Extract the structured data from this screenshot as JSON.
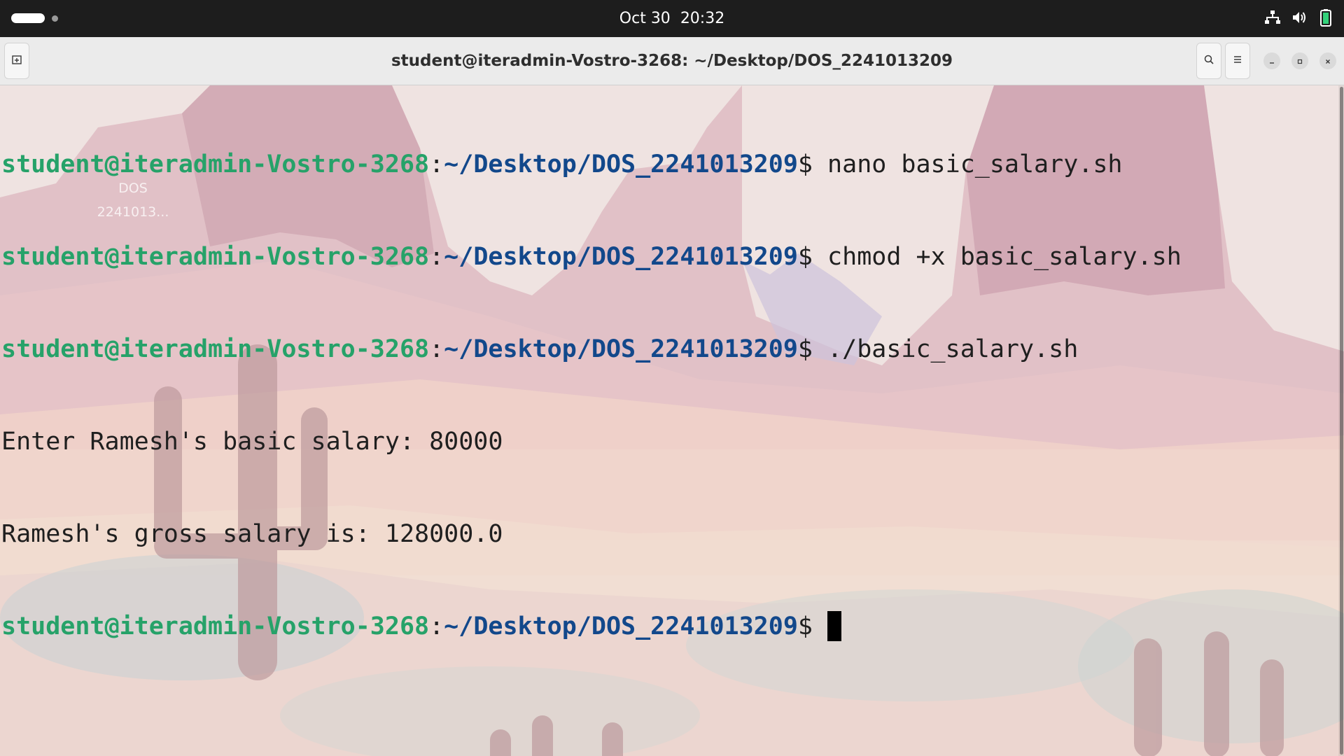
{
  "topbar": {
    "date": "Oct 30",
    "time": "20:32",
    "icons": [
      "network-wired-icon",
      "volume-icon",
      "battery-icon"
    ]
  },
  "window": {
    "title": "student@iteradmin-Vostro-3268: ~/Desktop/DOS_2241013209",
    "buttons": {
      "new_tab": "new-tab-icon",
      "search": "search-icon",
      "menu": "hamburger-menu-icon",
      "minimize": "minimize-icon",
      "maximize": "maximize-icon",
      "close": "close-icon"
    }
  },
  "desktop_icon_label": [
    "DOS",
    "2241013..."
  ],
  "prompt": {
    "user_host": "student@iteradmin-Vostro-3268",
    "colon": ":",
    "path": "~/Desktop/DOS_2241013209",
    "dollar": "$"
  },
  "terminal": {
    "commands": [
      " nano basic_salary.sh",
      " chmod +x basic_salary.sh",
      " ./basic_salary.sh"
    ],
    "output": [
      "Enter Ramesh's basic salary: 80000",
      "Ramesh's gross salary is: 128000.0"
    ],
    "current_input": " "
  },
  "colors": {
    "prompt_user": "#26a269",
    "prompt_path": "#12488b",
    "text": "#1f1f1f",
    "topbar_bg": "#1d1d1d",
    "headerbar_bg": "#ebebeb"
  }
}
